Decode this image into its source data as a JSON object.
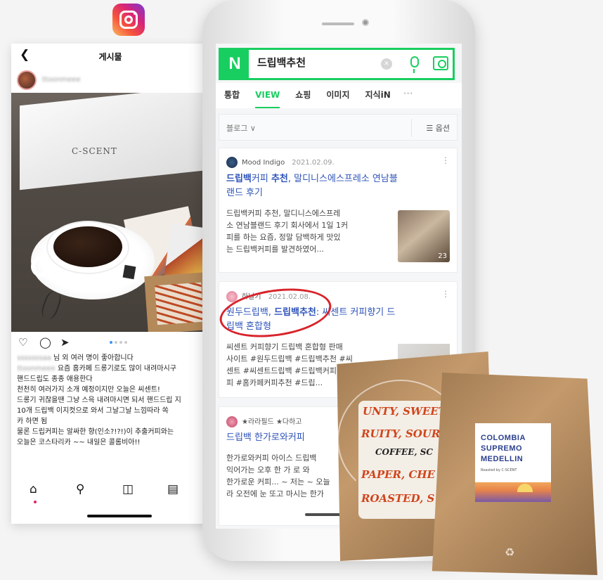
{
  "instagram": {
    "header_title": "게시물",
    "username": "ttoonmeee",
    "box_brand": "C-SCENT",
    "likes_prefix": "sssssssaa",
    "likes_suffix": "님 외 여러 명이 좋아합니다",
    "caption_author": "ttoonmeee",
    "caption_lines": [
      "요즘 홈카페 드롱기로도 많이 내려마시구",
      "핸드드립도 종종 애용한다",
      "천천히 여러가지 소개 예정이지만 오늘은 씨센트!",
      "드롱기 귀찮을땐 그냥 스윽 내려마시면 되서 핸드드립 지",
      "10개 드립백 이지컷으로 와서 그날그날 느낌따라 쏙",
      "카 하면 됨",
      "물론 드립커피는 알싸한 향(인소?!?!)이 추출커피와는",
      "오늘은 코스타리카 ~~ 내일은 콜롬비아!!"
    ]
  },
  "naver": {
    "search_query": "드립백추천",
    "tabs": [
      "통합",
      "VIEW",
      "쇼핑",
      "이미지",
      "지식iN"
    ],
    "active_tab": "VIEW",
    "filter_left": "블로그 ∨",
    "filter_right": "옵션",
    "posts": [
      {
        "author": "Mood Indigo",
        "date": "2021.02.09.",
        "title_html_parts": [
          "드립백",
          "커피 ",
          "추천",
          ", 말디니스에스프레소 연남블",
          "랜드 후기"
        ],
        "body_lines": [
          "드립백커피 추천, 말디니스에스프레",
          "소 연남블랜드 후기 회사에서 1일 1커",
          "피를 하는 요즘, 정말 담백하게 맛있",
          "는 드립백커피를 발견하였어..."
        ],
        "thumb_count": "23"
      },
      {
        "author": "하날기",
        "date": "2021.02.08.",
        "title_line1_a": "원두드립백, ",
        "title_line1_b": "드립백추천",
        "title_line1_c": ": 씨센트 커피향기 드",
        "title_line2": "립백 혼합형",
        "body_lines": [
          "씨센트 커피향기 드립백 혼합형 판매",
          "사이트 #원두드립백 #드립백추천 #씨",
          "센트 #씨센트드립백 #드립백커피",
          "피 #홈카페커피추천 #드립..."
        ]
      },
      {
        "author": "★라라필드 ★다하고",
        "title": "드립백 한가로와커피",
        "body_lines": [
          "한가로와커피 아이스 드립백",
          "익어가는 오후 한 가 로 와",
          "한가로운 커피... ~ 저는 ~ 오늘",
          "라 오전에 눈 또고 마시는 한가"
        ]
      }
    ]
  },
  "bag1_art_lines": [
    "UNTY, SWEET, J",
    "RUITY, SOUR",
    "COFFEE, SC",
    "PAPER, CHE",
    "ROASTED, S"
  ],
  "bag2": {
    "label_lines": [
      "COLOMBIA",
      "SUPREMO",
      "MEDELLIN"
    ],
    "roasted_by": "Roasted by C-SCENT"
  }
}
